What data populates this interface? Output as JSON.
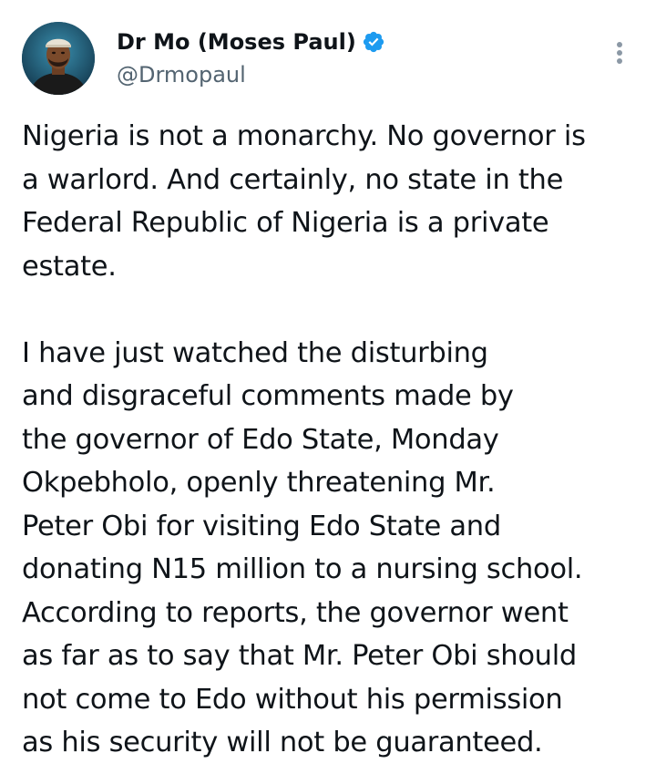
{
  "author": {
    "display_name": "Dr Mo (Moses Paul)",
    "handle": "@Drmopaul",
    "verified": true,
    "avatar_icon": "profile-photo",
    "verified_color": "#1d9bf0"
  },
  "actions": {
    "more_icon": "more-vertical-icon"
  },
  "tweet": {
    "paragraphs": [
      {
        "lines": [
          "Nigeria is not a monarchy. No governor is",
          "a warlord. And certainly, no state in the",
          "Federal Republic of Nigeria is a private",
          "estate."
        ]
      },
      {
        "lines": [
          "I have just watched the disturbing",
          "and disgraceful comments made by",
          "the governor of Edo State, Monday",
          "Okpebholo, openly threatening Mr.",
          "Peter Obi for visiting Edo State and",
          "donating N15 million to a nursing school.",
          "According to reports, the governor went",
          "as far as to say that Mr. Peter Obi should",
          "not come to Edo without his permission",
          "as his security will not be guaranteed."
        ]
      }
    ]
  }
}
